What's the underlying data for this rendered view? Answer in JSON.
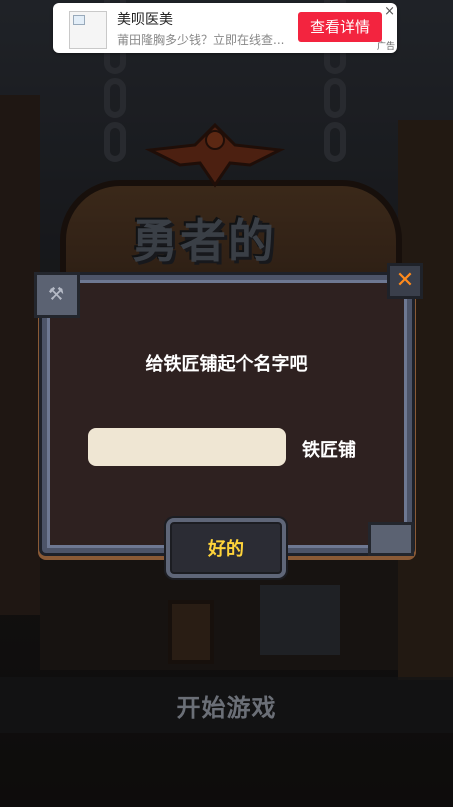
{
  "ad": {
    "title": "美呗医美",
    "description": "莆田隆胸多少钱？立即在线查...",
    "cta_label": "查看详情",
    "close_glyph": "×",
    "ad_label": "广告",
    "cta_color": "#f3243f"
  },
  "background": {
    "title_art": "勇者的"
  },
  "dialog": {
    "title": "给铁匠铺起个名字吧",
    "name_input": {
      "value": "",
      "placeholder": ""
    },
    "name_suffix": "铁匠铺",
    "ok_label": "好的",
    "close_icon": "close-icon",
    "ok_label_color": "#ffd43a"
  },
  "start": {
    "label": "开始游戏"
  }
}
